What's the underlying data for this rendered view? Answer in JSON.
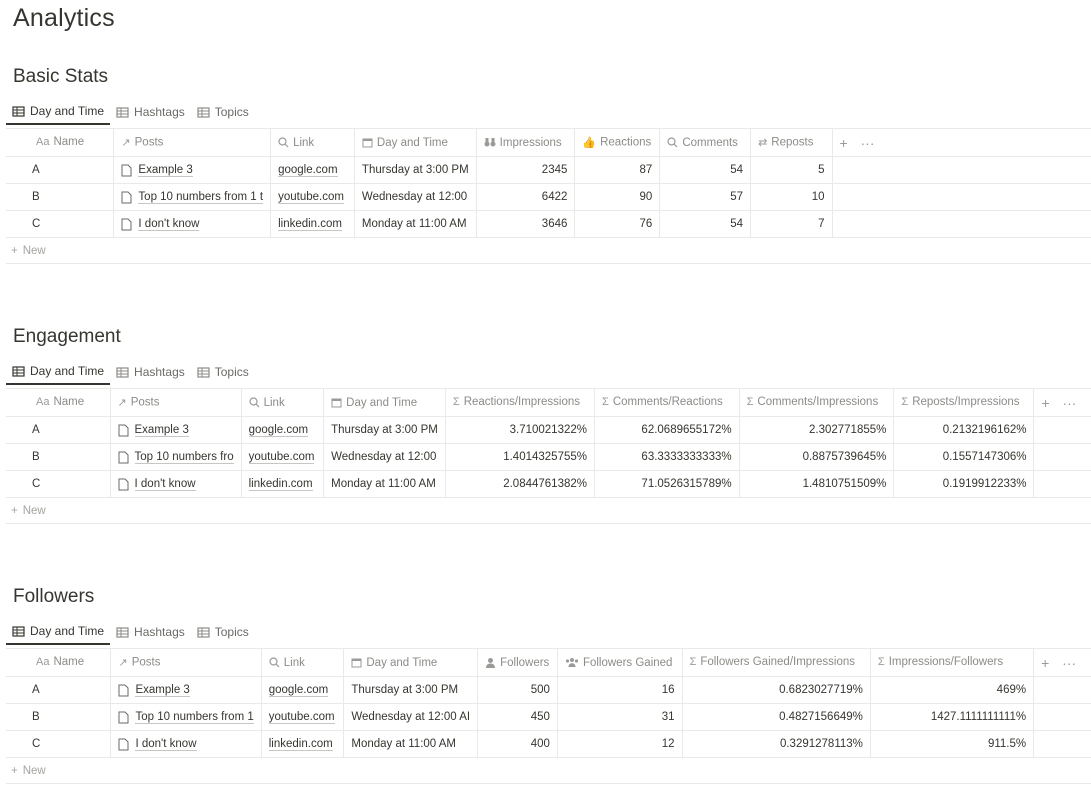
{
  "page_title": "Analytics",
  "view_tabs": [
    "Day and Time",
    "Hashtags",
    "Topics"
  ],
  "new_label": "New",
  "add_column": "+",
  "more": "···",
  "basic": {
    "title": "Basic Stats",
    "headers": [
      "Name",
      "Posts",
      "Link",
      "Day and Time",
      "Impressions",
      "Reactions",
      "Comments",
      "Reposts"
    ],
    "rows": [
      {
        "name": "A",
        "post": "Example 3",
        "link": "google.com",
        "when": "Thursday at 3:00 PM",
        "v": [
          "2345",
          "87",
          "54",
          "5"
        ]
      },
      {
        "name": "B",
        "post": "Top 10 numbers from 1 t",
        "link": "youtube.com",
        "when": "Wednesday at 12:00",
        "v": [
          "6422",
          "90",
          "57",
          "10"
        ]
      },
      {
        "name": "C",
        "post": "I don't know",
        "link": "linkedin.com",
        "when": "Monday at 11:00 AM",
        "v": [
          "3646",
          "76",
          "54",
          "7"
        ]
      }
    ]
  },
  "engagement": {
    "title": "Engagement",
    "headers": [
      "Name",
      "Posts",
      "Link",
      "Day and Time",
      "Reactions/Impressions",
      "Comments/Reactions",
      "Comments/Impressions",
      "Reposts/Impressions"
    ],
    "rows": [
      {
        "name": "A",
        "post": "Example 3",
        "link": "google.com",
        "when": "Thursday at 3:00 PM",
        "v": [
          "3.710021322%",
          "62.0689655172%",
          "2.302771855%",
          "0.2132196162%"
        ]
      },
      {
        "name": "B",
        "post": "Top 10 numbers fro",
        "link": "youtube.com",
        "when": "Wednesday at 12:00",
        "v": [
          "1.4014325755%",
          "63.3333333333%",
          "0.8875739645%",
          "0.1557147306%"
        ]
      },
      {
        "name": "C",
        "post": "I don't know",
        "link": "linkedin.com",
        "when": "Monday at 11:00 AM",
        "v": [
          "2.0844761382%",
          "71.0526315789%",
          "1.4810751509%",
          "0.1919912233%"
        ]
      }
    ]
  },
  "followers": {
    "title": "Followers",
    "headers": [
      "Name",
      "Posts",
      "Link",
      "Day and Time",
      "Followers",
      "Followers Gained",
      "Followers Gained/Impressions",
      "Impressions/Followers"
    ],
    "rows": [
      {
        "name": "A",
        "post": "Example 3",
        "link": "google.com",
        "when": "Thursday at 3:00 PM",
        "v": [
          "500",
          "16",
          "0.6823027719%",
          "469%"
        ]
      },
      {
        "name": "B",
        "post": "Top 10 numbers from 1",
        "link": "youtube.com",
        "when": "Wednesday at 12:00 AI",
        "v": [
          "450",
          "31",
          "0.4827156649%",
          "1427.1111111111%"
        ]
      },
      {
        "name": "C",
        "post": "I don't know",
        "link": "linkedin.com",
        "when": "Monday at 11:00 AM",
        "v": [
          "400",
          "12",
          "0.3291278113%",
          "911.5%"
        ]
      }
    ]
  }
}
